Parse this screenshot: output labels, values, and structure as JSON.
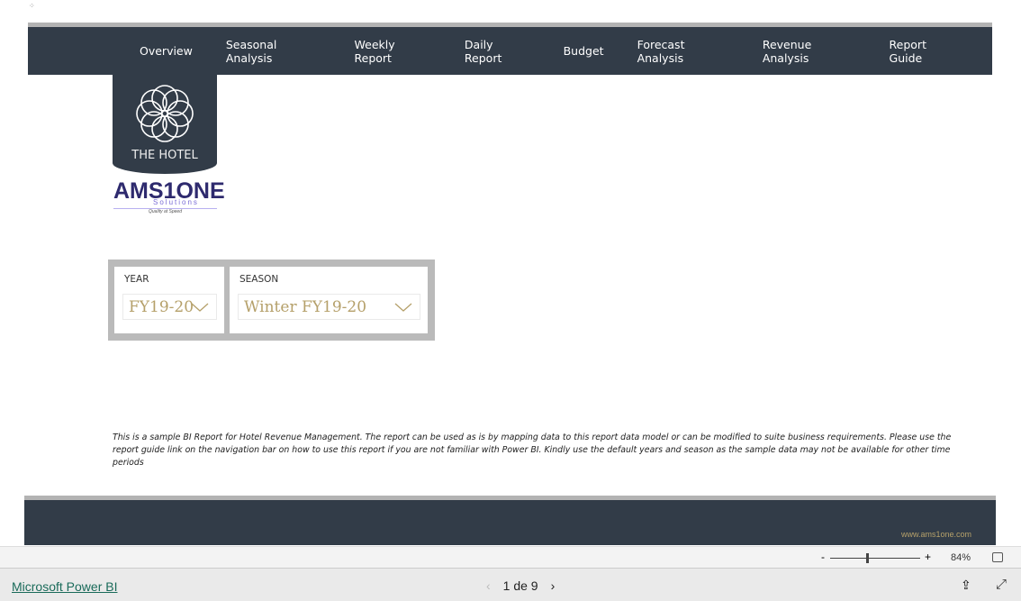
{
  "nav": {
    "items": [
      "Overview",
      "Seasonal Analysis",
      "Weekly Report",
      "Daily Report",
      "Budget",
      "Forecast Analysis",
      "Revenue Analysis",
      "Report Guide"
    ]
  },
  "logo": {
    "hotel": "THE HOTEL",
    "brand": "AMS1ONE",
    "brand_sub": "Solutions",
    "brand_tag": "Quality at Speed"
  },
  "slicers": {
    "year": {
      "label": "YEAR",
      "value": "FY19-20"
    },
    "season": {
      "label": "SEASON",
      "value": "Winter FY19-20"
    }
  },
  "description": "This is a sample BI Report for Hotel Revenue Management. The report can be used as is by mapping data to this report data model or can be modified to suite business requirements. Please use the report guide link on the navigation bar on how to use this report if you are not familiar with Power BI. Kindly use the default years and season as the sample data may not be available for other time periods",
  "footer": {
    "url": "www.ams1one.com"
  },
  "zoom": {
    "minus": "-",
    "plus": "+",
    "level": "84%",
    "level_value": 84
  },
  "bottom": {
    "app": "Microsoft Power BI",
    "page": "1 de 9",
    "prev": "‹",
    "next": "›"
  },
  "colors": {
    "nav_bg": "#323c48",
    "accent_gold": "#b5a06a"
  }
}
